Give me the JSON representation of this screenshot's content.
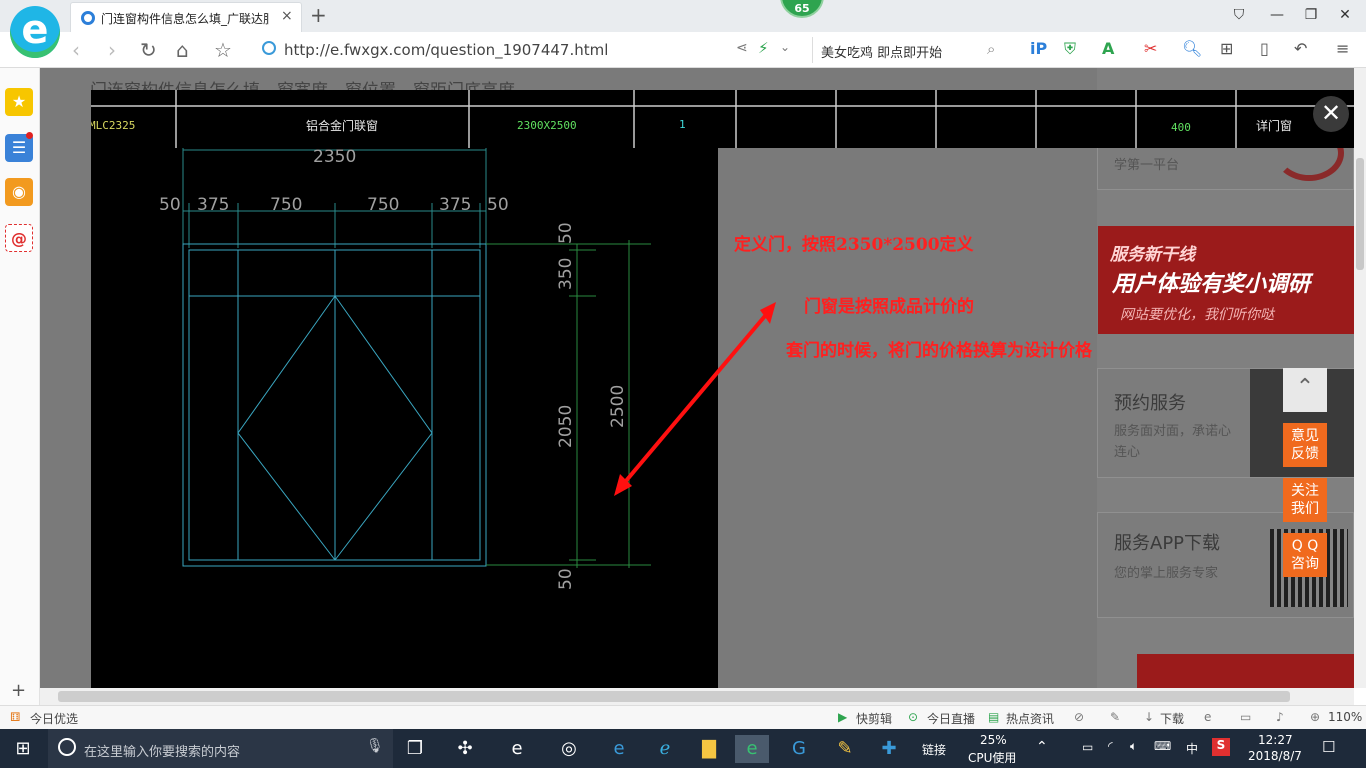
{
  "browser": {
    "tab_title": "门连窗构件信息怎么填_广联达服务",
    "tab_close": "×",
    "new_tab": "+",
    "badge": "65",
    "url": "http://e.fwxgx.com/question_1907447.html",
    "search_text": "美女吃鸡 即点即开始",
    "window_buttons": [
      "⛉",
      "—",
      "❐",
      "✕"
    ]
  },
  "page": {
    "bg_title": "门连窗构件信息怎么填，窗宽度，窗位置，窗距门底高度",
    "table_row": [
      "MLC2325",
      "铝合金门联窗",
      "2300X2500",
      "1",
      "400",
      "详门窗"
    ],
    "cad_dims": {
      "top": "2350",
      "segments": [
        "50",
        "375",
        "750",
        "750",
        "375",
        "50"
      ],
      "right_vertical": [
        "50",
        "350",
        "2050",
        "50"
      ],
      "total": "2500"
    },
    "annotations": [
      "定义门，按照2350*2500定义",
      "门窗是按照成品计价的",
      "套门的时候，将门的价格换算为设计价格"
    ],
    "right_column": {
      "top_desc": "学第一平台",
      "ad_title": "服务新干线",
      "ad_sub": "用户体验有奖小调研",
      "ad_line": "网站要优化，我们听你哒",
      "card1_title": "预约服务",
      "card1_desc": "服务面对面，承诺心连心",
      "card2_title": "服务APP下载",
      "card2_desc": "您的掌上服务专家"
    },
    "float_buttons": [
      "意见\n反馈",
      "关注\n我们",
      "Q Q\n咨询"
    ],
    "close": "✕"
  },
  "statusbar": {
    "left": "今日优选",
    "items": [
      "快剪辑",
      "今日直播",
      "热点资讯"
    ],
    "download": "下载",
    "zoom": "110%"
  },
  "taskbar": {
    "search_placeholder": "在这里输入你要搜索的内容",
    "links": "链接",
    "cpu_pct": "25%",
    "cpu_label": "CPU使用",
    "ime": "中",
    "time": "12:27",
    "date": "2018/8/7"
  }
}
